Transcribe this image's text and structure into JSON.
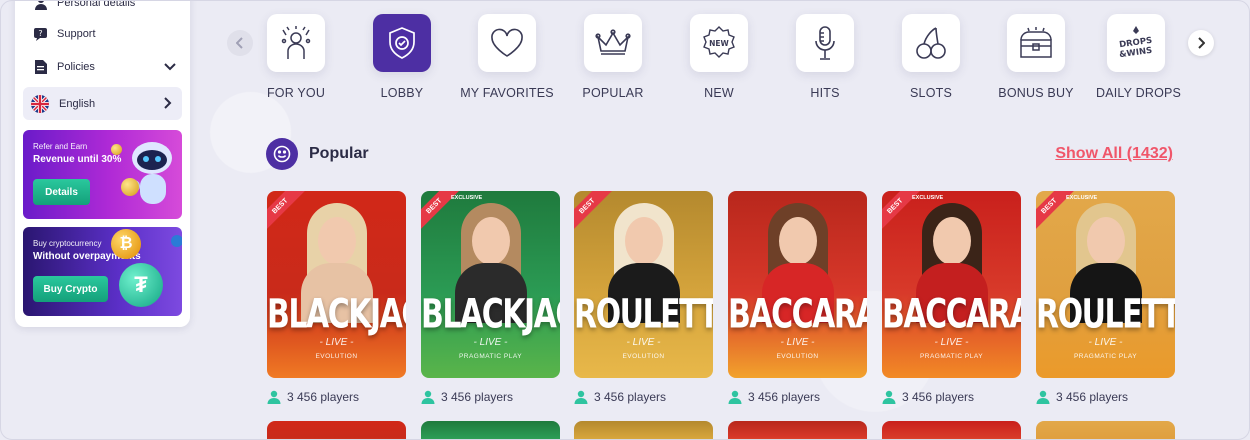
{
  "sidebar": {
    "items": [
      {
        "label": "Personal details",
        "icon": "person-icon"
      },
      {
        "label": "Support",
        "icon": "support-icon"
      },
      {
        "label": "Policies",
        "icon": "document-icon"
      }
    ],
    "language": {
      "label": "English",
      "flag": "uk-flag-icon"
    },
    "promos": [
      {
        "small": "Refer and Earn",
        "big": "Revenue until 30%",
        "button": "Details"
      },
      {
        "small": "Buy cryptocurrency",
        "big": "Without overpayments",
        "button": "Buy Crypto"
      }
    ]
  },
  "categories": [
    {
      "label": "FOR YOU",
      "icon": "gift-icon"
    },
    {
      "label": "LOBBY",
      "icon": "shield-check-icon",
      "active": true
    },
    {
      "label": "MY FAVORITES",
      "icon": "heart-icon"
    },
    {
      "label": "POPULAR",
      "icon": "crown-icon"
    },
    {
      "label": "NEW",
      "icon": "new-badge-icon"
    },
    {
      "label": "HITS",
      "icon": "microphone-icon"
    },
    {
      "label": "SLOTS",
      "icon": "cherry-icon"
    },
    {
      "label": "BONUS BUY",
      "icon": "treasure-chest-icon"
    },
    {
      "label": "DAILY DROPS",
      "icon": "drops-wins-icon"
    }
  ],
  "drops_icon_text": "DROPS & WINS",
  "new_badge_text": "NEW",
  "section": {
    "title": "Popular",
    "show_all": "Show All (1432)"
  },
  "games": [
    {
      "title": "BLACKJACK",
      "live": "- LIVE -",
      "provider": "EVOLUTION",
      "ribbon": "BEST",
      "exclusive": "",
      "players": "3 456 players"
    },
    {
      "title": "BLACKJACK",
      "live": "- LIVE -",
      "provider": "PRAGMATIC PLAY",
      "ribbon": "BEST",
      "exclusive": "EXCLUSIVE",
      "players": "3 456 players"
    },
    {
      "title": "ROULETTE",
      "live": "- LIVE -",
      "provider": "EVOLUTION",
      "ribbon": "BEST",
      "exclusive": "",
      "players": "3 456 players"
    },
    {
      "title": "BACCARAT",
      "live": "- LIVE -",
      "provider": "EVOLUTION",
      "ribbon": "",
      "exclusive": "",
      "players": "3 456 players"
    },
    {
      "title": "BACCARAT",
      "live": "- LIVE -",
      "provider": "PRAGMATIC PLAY",
      "ribbon": "BEST",
      "exclusive": "EXCLUSIVE",
      "players": "3 456 players"
    },
    {
      "title": "ROULETTE",
      "live": "- LIVE -",
      "provider": "PRAGMATIC PLAY",
      "ribbon": "BEST",
      "exclusive": "EXCLUSIVE",
      "players": "3 456 players"
    }
  ],
  "colors": {
    "accent": "#4d2fa3",
    "show_all": "#f0566a",
    "button_green": "#14a07a",
    "ribbon": "#e63946"
  }
}
